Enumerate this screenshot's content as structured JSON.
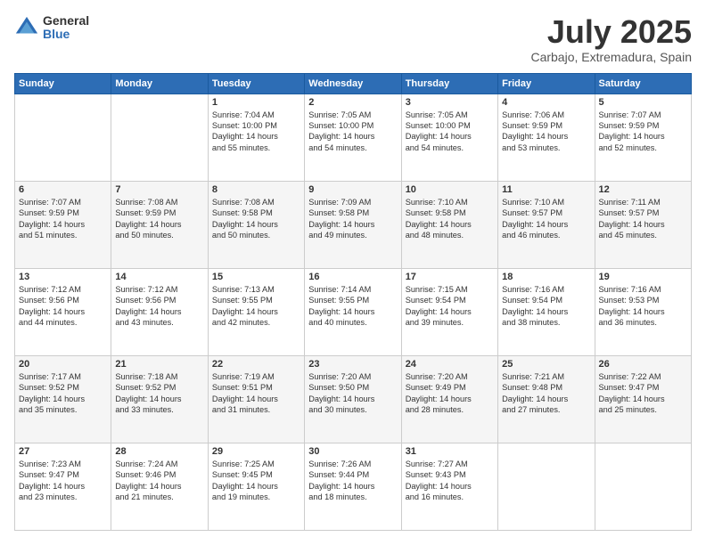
{
  "logo": {
    "general": "General",
    "blue": "Blue"
  },
  "header": {
    "month": "July 2025",
    "location": "Carbajo, Extremadura, Spain"
  },
  "weekdays": [
    "Sunday",
    "Monday",
    "Tuesday",
    "Wednesday",
    "Thursday",
    "Friday",
    "Saturday"
  ],
  "weeks": [
    [
      {
        "day": "",
        "content": ""
      },
      {
        "day": "",
        "content": ""
      },
      {
        "day": "1",
        "content": "Sunrise: 7:04 AM\nSunset: 10:00 PM\nDaylight: 14 hours\nand 55 minutes."
      },
      {
        "day": "2",
        "content": "Sunrise: 7:05 AM\nSunset: 10:00 PM\nDaylight: 14 hours\nand 54 minutes."
      },
      {
        "day": "3",
        "content": "Sunrise: 7:05 AM\nSunset: 10:00 PM\nDaylight: 14 hours\nand 54 minutes."
      },
      {
        "day": "4",
        "content": "Sunrise: 7:06 AM\nSunset: 9:59 PM\nDaylight: 14 hours\nand 53 minutes."
      },
      {
        "day": "5",
        "content": "Sunrise: 7:07 AM\nSunset: 9:59 PM\nDaylight: 14 hours\nand 52 minutes."
      }
    ],
    [
      {
        "day": "6",
        "content": "Sunrise: 7:07 AM\nSunset: 9:59 PM\nDaylight: 14 hours\nand 51 minutes."
      },
      {
        "day": "7",
        "content": "Sunrise: 7:08 AM\nSunset: 9:59 PM\nDaylight: 14 hours\nand 50 minutes."
      },
      {
        "day": "8",
        "content": "Sunrise: 7:08 AM\nSunset: 9:58 PM\nDaylight: 14 hours\nand 50 minutes."
      },
      {
        "day": "9",
        "content": "Sunrise: 7:09 AM\nSunset: 9:58 PM\nDaylight: 14 hours\nand 49 minutes."
      },
      {
        "day": "10",
        "content": "Sunrise: 7:10 AM\nSunset: 9:58 PM\nDaylight: 14 hours\nand 48 minutes."
      },
      {
        "day": "11",
        "content": "Sunrise: 7:10 AM\nSunset: 9:57 PM\nDaylight: 14 hours\nand 46 minutes."
      },
      {
        "day": "12",
        "content": "Sunrise: 7:11 AM\nSunset: 9:57 PM\nDaylight: 14 hours\nand 45 minutes."
      }
    ],
    [
      {
        "day": "13",
        "content": "Sunrise: 7:12 AM\nSunset: 9:56 PM\nDaylight: 14 hours\nand 44 minutes."
      },
      {
        "day": "14",
        "content": "Sunrise: 7:12 AM\nSunset: 9:56 PM\nDaylight: 14 hours\nand 43 minutes."
      },
      {
        "day": "15",
        "content": "Sunrise: 7:13 AM\nSunset: 9:55 PM\nDaylight: 14 hours\nand 42 minutes."
      },
      {
        "day": "16",
        "content": "Sunrise: 7:14 AM\nSunset: 9:55 PM\nDaylight: 14 hours\nand 40 minutes."
      },
      {
        "day": "17",
        "content": "Sunrise: 7:15 AM\nSunset: 9:54 PM\nDaylight: 14 hours\nand 39 minutes."
      },
      {
        "day": "18",
        "content": "Sunrise: 7:16 AM\nSunset: 9:54 PM\nDaylight: 14 hours\nand 38 minutes."
      },
      {
        "day": "19",
        "content": "Sunrise: 7:16 AM\nSunset: 9:53 PM\nDaylight: 14 hours\nand 36 minutes."
      }
    ],
    [
      {
        "day": "20",
        "content": "Sunrise: 7:17 AM\nSunset: 9:52 PM\nDaylight: 14 hours\nand 35 minutes."
      },
      {
        "day": "21",
        "content": "Sunrise: 7:18 AM\nSunset: 9:52 PM\nDaylight: 14 hours\nand 33 minutes."
      },
      {
        "day": "22",
        "content": "Sunrise: 7:19 AM\nSunset: 9:51 PM\nDaylight: 14 hours\nand 31 minutes."
      },
      {
        "day": "23",
        "content": "Sunrise: 7:20 AM\nSunset: 9:50 PM\nDaylight: 14 hours\nand 30 minutes."
      },
      {
        "day": "24",
        "content": "Sunrise: 7:20 AM\nSunset: 9:49 PM\nDaylight: 14 hours\nand 28 minutes."
      },
      {
        "day": "25",
        "content": "Sunrise: 7:21 AM\nSunset: 9:48 PM\nDaylight: 14 hours\nand 27 minutes."
      },
      {
        "day": "26",
        "content": "Sunrise: 7:22 AM\nSunset: 9:47 PM\nDaylight: 14 hours\nand 25 minutes."
      }
    ],
    [
      {
        "day": "27",
        "content": "Sunrise: 7:23 AM\nSunset: 9:47 PM\nDaylight: 14 hours\nand 23 minutes."
      },
      {
        "day": "28",
        "content": "Sunrise: 7:24 AM\nSunset: 9:46 PM\nDaylight: 14 hours\nand 21 minutes."
      },
      {
        "day": "29",
        "content": "Sunrise: 7:25 AM\nSunset: 9:45 PM\nDaylight: 14 hours\nand 19 minutes."
      },
      {
        "day": "30",
        "content": "Sunrise: 7:26 AM\nSunset: 9:44 PM\nDaylight: 14 hours\nand 18 minutes."
      },
      {
        "day": "31",
        "content": "Sunrise: 7:27 AM\nSunset: 9:43 PM\nDaylight: 14 hours\nand 16 minutes."
      },
      {
        "day": "",
        "content": ""
      },
      {
        "day": "",
        "content": ""
      }
    ]
  ]
}
